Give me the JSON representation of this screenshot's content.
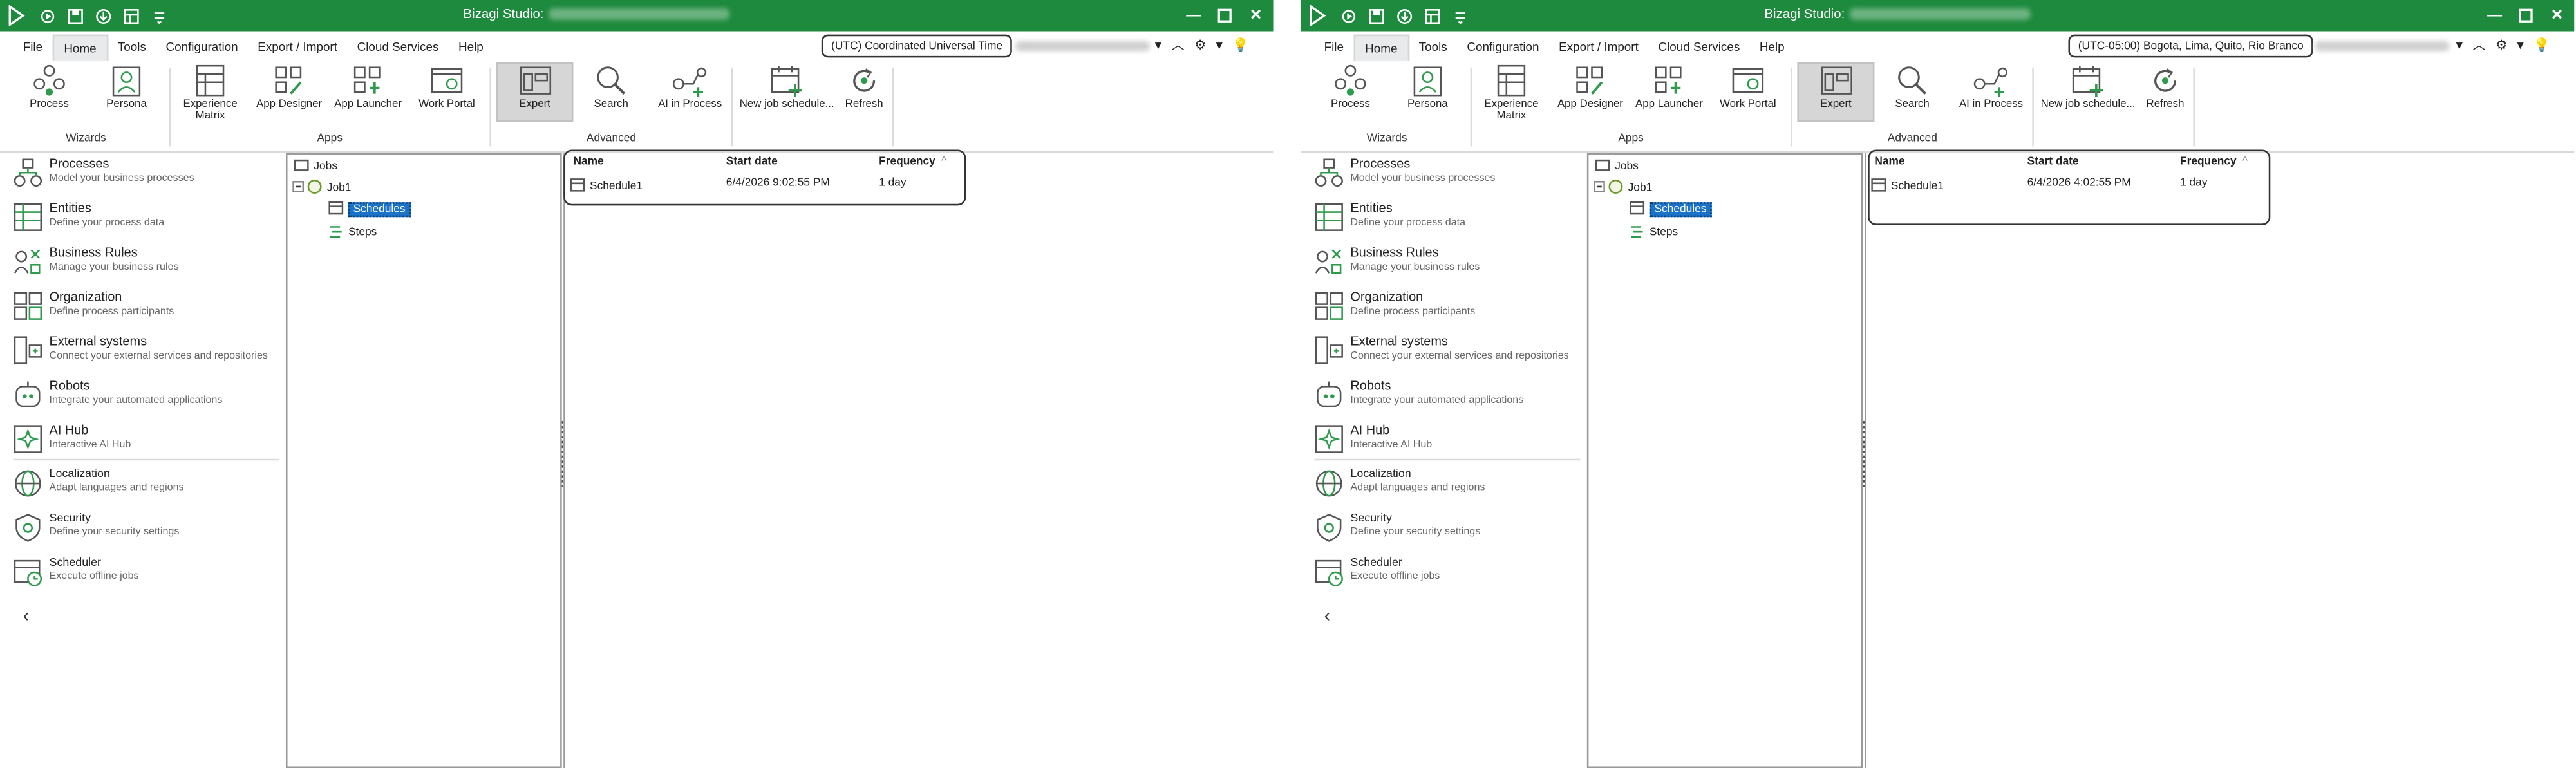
{
  "app": {
    "title": "Bizagi Studio:",
    "window_controls": [
      "minimize",
      "maximize",
      "close"
    ]
  },
  "menu": {
    "items": [
      "File",
      "Home",
      "Tools",
      "Configuration",
      "Export / Import",
      "Cloud Services",
      "Help"
    ],
    "active": "Home"
  },
  "ribbon": {
    "groups": {
      "wizards": "Wizards",
      "apps": "Apps",
      "advanced": "Advanced"
    },
    "buttons": {
      "process": "Process",
      "persona": "Persona",
      "experience_line1": "Experience",
      "experience_line2": "Matrix",
      "app_designer": "App Designer",
      "app_launcher": "App Launcher",
      "work_portal": "Work Portal",
      "expert": "Expert",
      "search": "Search",
      "ai_in_process": "AI in Process",
      "new_job_schedule": "New job schedule...",
      "refresh": "Refresh"
    }
  },
  "nav": {
    "items": [
      {
        "title": "Processes",
        "sub": "Model your business processes",
        "icon": "processes-icon"
      },
      {
        "title": "Entities",
        "sub": "Define your process data",
        "icon": "entities-icon"
      },
      {
        "title": "Business Rules",
        "sub": "Manage your business rules",
        "icon": "business-rules-icon"
      },
      {
        "title": "Organization",
        "sub": "Define process participants",
        "icon": "organization-icon"
      },
      {
        "title": "External systems",
        "sub": "Connect your external services and repositories",
        "icon": "external-systems-icon"
      },
      {
        "title": "Robots",
        "sub": "Integrate your automated applications",
        "icon": "robot-icon"
      },
      {
        "title": "AI Hub",
        "sub": "Interactive AI Hub",
        "icon": "ai-hub-icon"
      },
      {
        "title": "Localization",
        "sub": "Adapt languages and regions",
        "icon": "globe-icon"
      },
      {
        "title": "Security",
        "sub": "Define your security settings",
        "icon": "security-gear-icon"
      },
      {
        "title": "Scheduler",
        "sub": "Execute offline jobs",
        "icon": "scheduler-icon"
      }
    ]
  },
  "tree": {
    "root": "Jobs",
    "job": "Job1",
    "schedules": "Schedules",
    "steps": "Steps"
  },
  "grid": {
    "columns": [
      "Name",
      "Start date",
      "Frequency"
    ],
    "sort_indicator": "^"
  },
  "panels": [
    {
      "timezone": "(UTC) Coordinated Universal Time",
      "row": {
        "name": "Schedule1",
        "start": "6/4/2026 9:02:55 PM",
        "frequency": "1 day"
      }
    },
    {
      "timezone": "(UTC-05:00) Bogota, Lima, Quito, Rio Branco",
      "row": {
        "name": "Schedule1",
        "start": "6/4/2026 4:02:55 PM",
        "frequency": "1 day"
      }
    }
  ],
  "colors": {
    "titlebar": "#1e8a3e",
    "selection": "#1a73c8",
    "icon_green": "#2e9a4c",
    "icon_gray": "#555555"
  }
}
